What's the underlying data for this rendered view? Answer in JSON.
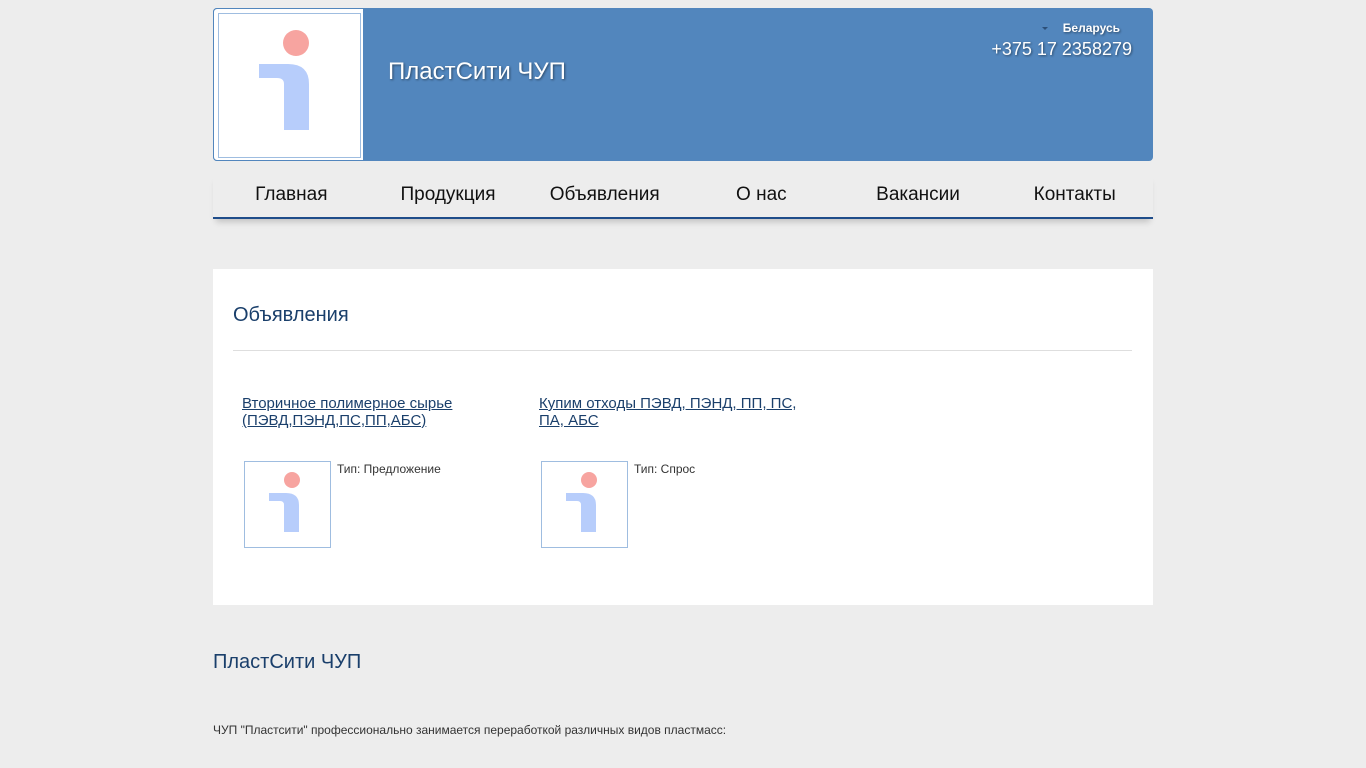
{
  "header": {
    "company_name": "ПластСити ЧУП",
    "region": "Беларусь",
    "phone": "+375 17 2358279"
  },
  "nav": {
    "items": [
      {
        "label": "Главная"
      },
      {
        "label": "Продукция"
      },
      {
        "label": "Объявления"
      },
      {
        "label": "О нас"
      },
      {
        "label": "Вакансии"
      },
      {
        "label": "Контакты"
      }
    ]
  },
  "main": {
    "title": "Объявления",
    "ads": [
      {
        "title": "Вторичное полимерное сырье (ПЭВД,ПЭНД,ПС,ПП,АБС)",
        "type": "Тип: Предложение"
      },
      {
        "title": "Купим отходы ПЭВД, ПЭНД, ПП, ПС, ПА, АБС",
        "type": "Тип: Спрос"
      }
    ]
  },
  "footer": {
    "title": "ПластСити ЧУП",
    "description": "ЧУП \"Пластсити\" профессионально занимается переработкой различных видов пластмасс:"
  },
  "icons": {
    "logo": "info-icon",
    "thumbnail": "info-icon"
  },
  "colors": {
    "header_bg": "#5286bd",
    "nav_border": "#1f4d8a",
    "heading": "#1a3f6b",
    "logo_dot": "#f7a4a0",
    "logo_stem": "#b7cdfb"
  }
}
